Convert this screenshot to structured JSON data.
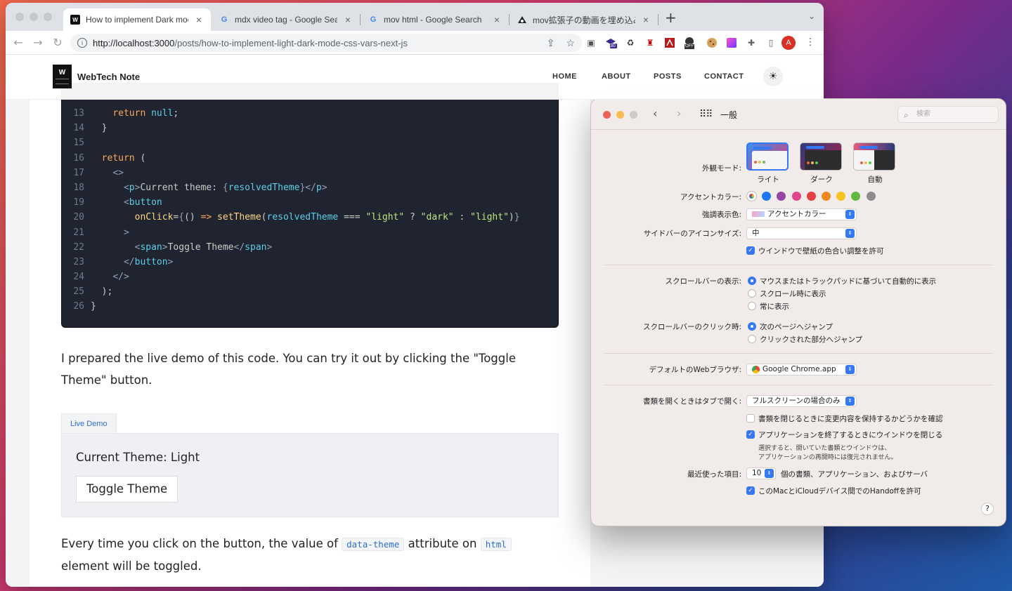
{
  "browser": {
    "tabs": [
      {
        "title": "How to implement Dark mode w",
        "favicon": "W",
        "active": true
      },
      {
        "title": "mdx video tag - Google Search",
        "favicon": "G",
        "active": false
      },
      {
        "title": "mov html - Google Search",
        "favicon": "G",
        "active": false
      },
      {
        "title": "mov拡張子の動画を埋め込み再生す",
        "favicon": "logo",
        "active": false
      }
    ],
    "url_host": "http://localhost:3000",
    "url_path": "/posts/how-to-implement-light-dark-mode-css-vars-next-js",
    "avatar_letter": "A",
    "ext_badge_30": "30",
    "ext_badge_off": "OFF"
  },
  "site": {
    "logo_letter": "W",
    "name": "WebTech Note",
    "nav": [
      "HOME",
      "ABOUT",
      "POSTS",
      "CONTACT"
    ]
  },
  "code": {
    "lines": [
      {
        "n": "13",
        "html": "    <span class='kw'>return</span> <span class='tg'>null</span>;"
      },
      {
        "n": "14",
        "html": "  }"
      },
      {
        "n": "15",
        "html": ""
      },
      {
        "n": "16",
        "html": "  <span class='kw'>return</span> ("
      },
      {
        "n": "17",
        "html": "    <span class='pu'>&lt;&gt;</span>"
      },
      {
        "n": "18",
        "html": "      <span class='pu'>&lt;</span><span class='tg'>p</span><span class='pu'>&gt;</span>Current theme: <span class='pu'>{</span><span class='tg'>resolvedTheme</span><span class='pu'>}&lt;/</span><span class='tg'>p</span><span class='pu'>&gt;</span>"
      },
      {
        "n": "19",
        "html": "      <span class='pu'>&lt;</span><span class='tg'>button</span>"
      },
      {
        "n": "20",
        "html": "        <span class='at'>onClick</span>=<span class='pu'>{</span>() <span class='kw'>=&gt;</span> <span class='at'>setTheme</span>(<span class='tg'>resolvedTheme</span> === <span class='st'>\"light\"</span> ? <span class='st'>\"dark\"</span> : <span class='st'>\"light\"</span>)<span class='pu'>}</span>"
      },
      {
        "n": "21",
        "html": "      <span class='pu'>&gt;</span>"
      },
      {
        "n": "22",
        "html": "        <span class='pu'>&lt;</span><span class='tg'>span</span><span class='pu'>&gt;</span>Toggle Theme<span class='pu'>&lt;/</span><span class='tg'>span</span><span class='pu'>&gt;</span>"
      },
      {
        "n": "23",
        "html": "      <span class='pu'>&lt;/</span><span class='tg'>button</span><span class='pu'>&gt;</span>"
      },
      {
        "n": "24",
        "html": "    <span class='pu'>&lt;/&gt;</span>"
      },
      {
        "n": "25",
        "html": "  );"
      },
      {
        "n": "26",
        "html": "}"
      }
    ]
  },
  "article": {
    "para1": "I prepared the live demo of this code. You can try it out by clicking the \"Toggle Theme\" button.",
    "demo_tab": "Live Demo",
    "demo_text": "Current Theme: Light",
    "demo_button": "Toggle Theme",
    "para2_a": "Every time you click on the button, the value of",
    "para2_code1": "data-theme",
    "para2_b": "attribute on",
    "para2_code2": "html",
    "para2_c": "element will be toggled."
  },
  "prefs": {
    "title": "一般",
    "search_placeholder": "検索",
    "appearance_label": "外観モード:",
    "appearance_options": [
      "ライト",
      "ダーク",
      "自動"
    ],
    "accent_label": "アクセントカラー:",
    "accent_colors": [
      "#ffffff",
      "#1e74f5",
      "#9646a3",
      "#e0468c",
      "#e24043",
      "#f28722",
      "#f5c421",
      "#5fb83f",
      "#8c8c8c"
    ],
    "highlight_label": "強調表示色:",
    "highlight_value": "アクセントカラー",
    "sidebar_label": "サイドバーのアイコンサイズ:",
    "sidebar_value": "中",
    "wallpaper_tint": "ウインドウで壁紙の色合い調整を許可",
    "scrollbar_label": "スクロールバーの表示:",
    "scrollbar_options": [
      "マウスまたはトラックパッドに基づいて自動的に表示",
      "スクロール時に表示",
      "常に表示"
    ],
    "scrollclick_label": "スクロールバーのクリック時:",
    "scrollclick_options": [
      "次のページへジャンプ",
      "クリックされた部分へジャンプ"
    ],
    "browser_label": "デフォルトのWebブラウザ:",
    "browser_value": "Google Chrome.app",
    "tabs_label": "書類を開くときはタブで開く:",
    "tabs_value": "フルスクリーンの場合のみ",
    "ask_keep": "書類を閉じるときに変更内容を保持するかどうかを確認",
    "close_windows": "アプリケーションを終了するときにウインドウを閉じる",
    "close_note_1": "選択すると、開いていた書類とウインドウは、",
    "close_note_2": "アプリケーションの再開時には復元されません。",
    "recent_label": "最近使った項目:",
    "recent_value": "10",
    "recent_suffix": "個の書類、アプリケーション、およびサーバ",
    "handoff": "このMacとiCloudデバイス間でのHandoffを許可",
    "help": "?"
  }
}
